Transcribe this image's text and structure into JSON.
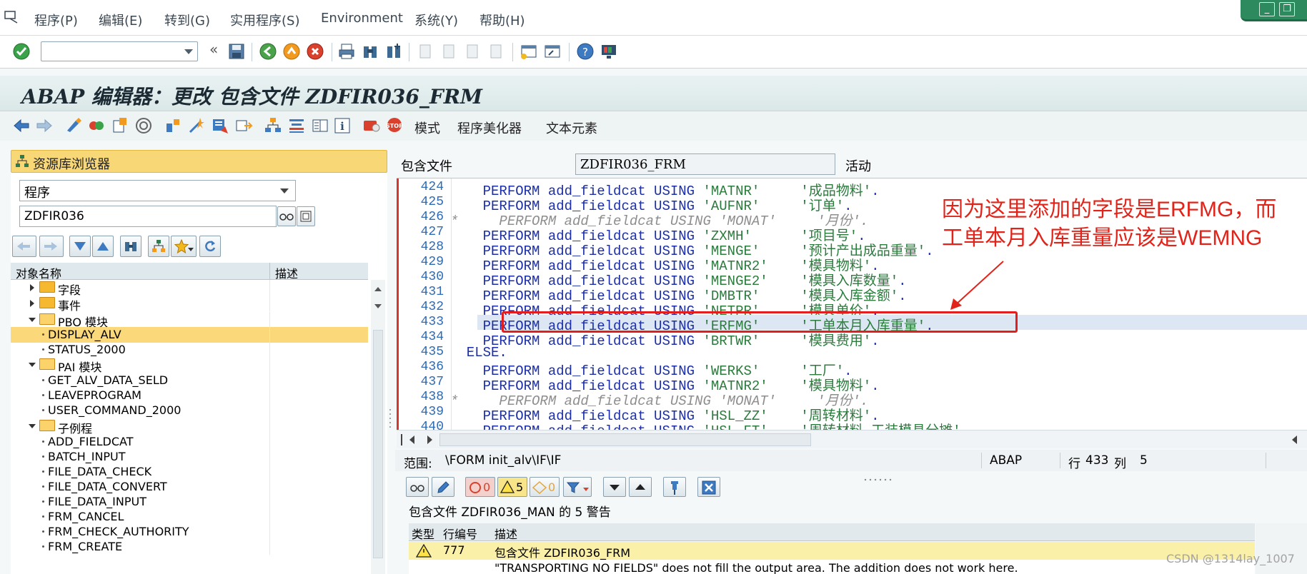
{
  "menu": [
    "程序(P)",
    "编辑(E)",
    "转到(G)",
    "实用程序(S)",
    "Environment",
    "系统(Y)",
    "帮助(H)"
  ],
  "title": "ABAP 编辑器：更改 包含文件 ZDFIR036_FRM",
  "app_toolbar": {
    "mode_label": "模式",
    "pretty_printer_label": "程序美化器",
    "text_elements_label": "文本元素"
  },
  "repository_browser": {
    "header": "资源库浏览器",
    "object_type": "程序",
    "object_name": "ZDFIR036",
    "col_name": "对象名称",
    "col_desc": "描述",
    "tree": [
      {
        "label": "字段",
        "kind": "folder",
        "expanded": false,
        "level": 1
      },
      {
        "label": "事件",
        "kind": "folder",
        "expanded": false,
        "level": 1
      },
      {
        "label": "PBO 模块",
        "kind": "folder",
        "expanded": true,
        "level": 1
      },
      {
        "label": "DISPLAY_ALV",
        "kind": "leaf",
        "level": 2,
        "selected": true
      },
      {
        "label": "STATUS_2000",
        "kind": "leaf",
        "level": 2
      },
      {
        "label": "PAI 模块",
        "kind": "folder",
        "expanded": true,
        "level": 1
      },
      {
        "label": "GET_ALV_DATA_SELD",
        "kind": "leaf",
        "level": 2
      },
      {
        "label": "LEAVEPROGRAM",
        "kind": "leaf",
        "level": 2
      },
      {
        "label": "USER_COMMAND_2000",
        "kind": "leaf",
        "level": 2
      },
      {
        "label": "子例程",
        "kind": "folder",
        "expanded": true,
        "level": 1
      },
      {
        "label": "ADD_FIELDCAT",
        "kind": "leaf",
        "level": 2
      },
      {
        "label": "BATCH_INPUT",
        "kind": "leaf",
        "level": 2
      },
      {
        "label": "FILE_DATA_CHECK",
        "kind": "leaf",
        "level": 2
      },
      {
        "label": "FILE_DATA_CONVERT",
        "kind": "leaf",
        "level": 2
      },
      {
        "label": "FILE_DATA_INPUT",
        "kind": "leaf",
        "level": 2
      },
      {
        "label": "FRM_CANCEL",
        "kind": "leaf",
        "level": 2
      },
      {
        "label": "FRM_CHECK_AUTHORITY",
        "kind": "leaf",
        "level": 2
      },
      {
        "label": "FRM_CREATE",
        "kind": "leaf",
        "level": 2
      }
    ]
  },
  "include": {
    "label": "包含文件",
    "name": "ZDFIR036_FRM",
    "status": "活动"
  },
  "code": [
    {
      "line": "424",
      "pre": "    PERFORM add_fieldcat USING ",
      "lit": "'MATNR'     '成品物料'",
      "post": ".",
      "comment": false
    },
    {
      "line": "425",
      "pre": "    PERFORM add_fieldcat USING ",
      "lit": "'AUFNR'     '订单'",
      "post": ".",
      "comment": false
    },
    {
      "line": "426",
      "pre": "*     PERFORM add_fieldcat USING 'MONAT'     '月份'.",
      "lit": "",
      "post": "",
      "comment": true
    },
    {
      "line": "427",
      "pre": "    PERFORM add_fieldcat USING ",
      "lit": "'ZXMH'      '项目号'",
      "post": ".",
      "comment": false
    },
    {
      "line": "428",
      "pre": "    PERFORM add_fieldcat USING ",
      "lit": "'MENGE'     '预计产出成品重量'",
      "post": ".",
      "comment": false
    },
    {
      "line": "429",
      "pre": "    PERFORM add_fieldcat USING ",
      "lit": "'MATNR2'    '模具物料'",
      "post": ".",
      "comment": false
    },
    {
      "line": "430",
      "pre": "    PERFORM add_fieldcat USING ",
      "lit": "'MENGE2'    '模具入库数量'",
      "post": ".",
      "comment": false
    },
    {
      "line": "431",
      "pre": "    PERFORM add_fieldcat USING ",
      "lit": "'DMBTR'     '模具入库金额'",
      "post": ".",
      "comment": false
    },
    {
      "line": "432",
      "pre": "    PERFORM add_fieldcat USING ",
      "lit": "'NETPR'     '模具单价'",
      "post": ".",
      "comment": false
    },
    {
      "line": "433",
      "pre": "    PERFORM add_fieldcat USING ",
      "lit": "'ERFMG'     '工单本月入库重量'",
      "post": ".",
      "comment": false,
      "highlight": true
    },
    {
      "line": "434",
      "pre": "    PERFORM add_fieldcat USING ",
      "lit": "'BRTWR'     '模具费用'",
      "post": ".",
      "comment": false
    },
    {
      "line": "435",
      "pre": "  ELSE.",
      "lit": "",
      "post": "",
      "comment": false
    },
    {
      "line": "436",
      "pre": "    PERFORM add_fieldcat USING ",
      "lit": "'WERKS'     '工厂'",
      "post": ".",
      "comment": false
    },
    {
      "line": "437",
      "pre": "    PERFORM add_fieldcat USING ",
      "lit": "'MATNR2'    '模具物料'",
      "post": ".",
      "comment": false
    },
    {
      "line": "438",
      "pre": "*     PERFORM add_fieldcat USING 'MONAT'     '月份'.",
      "lit": "",
      "post": "",
      "comment": true
    },
    {
      "line": "439",
      "pre": "    PERFORM add_fieldcat USING ",
      "lit": "'HSL_ZZ'    '周转材料'",
      "post": ".",
      "comment": false
    },
    {
      "line": "440",
      "pre": "    PERFORM add_fieldcat USING ",
      "lit": "'HSL_FT'    '周转材料-工装模具分摊'",
      "post": ".",
      "comment": false
    }
  ],
  "annotation": [
    "因为这里添加的字段是ERFMG，而",
    "工单本月入库重量应该是WEMNG"
  ],
  "statusline": {
    "scope_label": "范围:",
    "scope_value": "\\FORM init_alv\\IF\\IF",
    "language": "ABAP",
    "line_label": "行",
    "line_value": "433",
    "col_label": "列",
    "col_value": "5"
  },
  "messages": {
    "errors": "0",
    "warnings": "5",
    "infos": "0",
    "summary": "包含文件 ZDFIR036_MAN 的 5 警告",
    "col_type": "类型",
    "col_line": "行编号",
    "col_desc": "描述",
    "row1_line": "777",
    "row1_desc": "包含文件 ZDFIR036_FRM",
    "row2_desc": "\"TRANSPORTING NO FIELDS\" does not fill the output area. The addition does not work here."
  },
  "watermark": "CSDN @1314lay_1007",
  "colors": {
    "accent": "#f8d777",
    "highlight_box": "#e31e1e",
    "annotation": "#e2231a"
  }
}
